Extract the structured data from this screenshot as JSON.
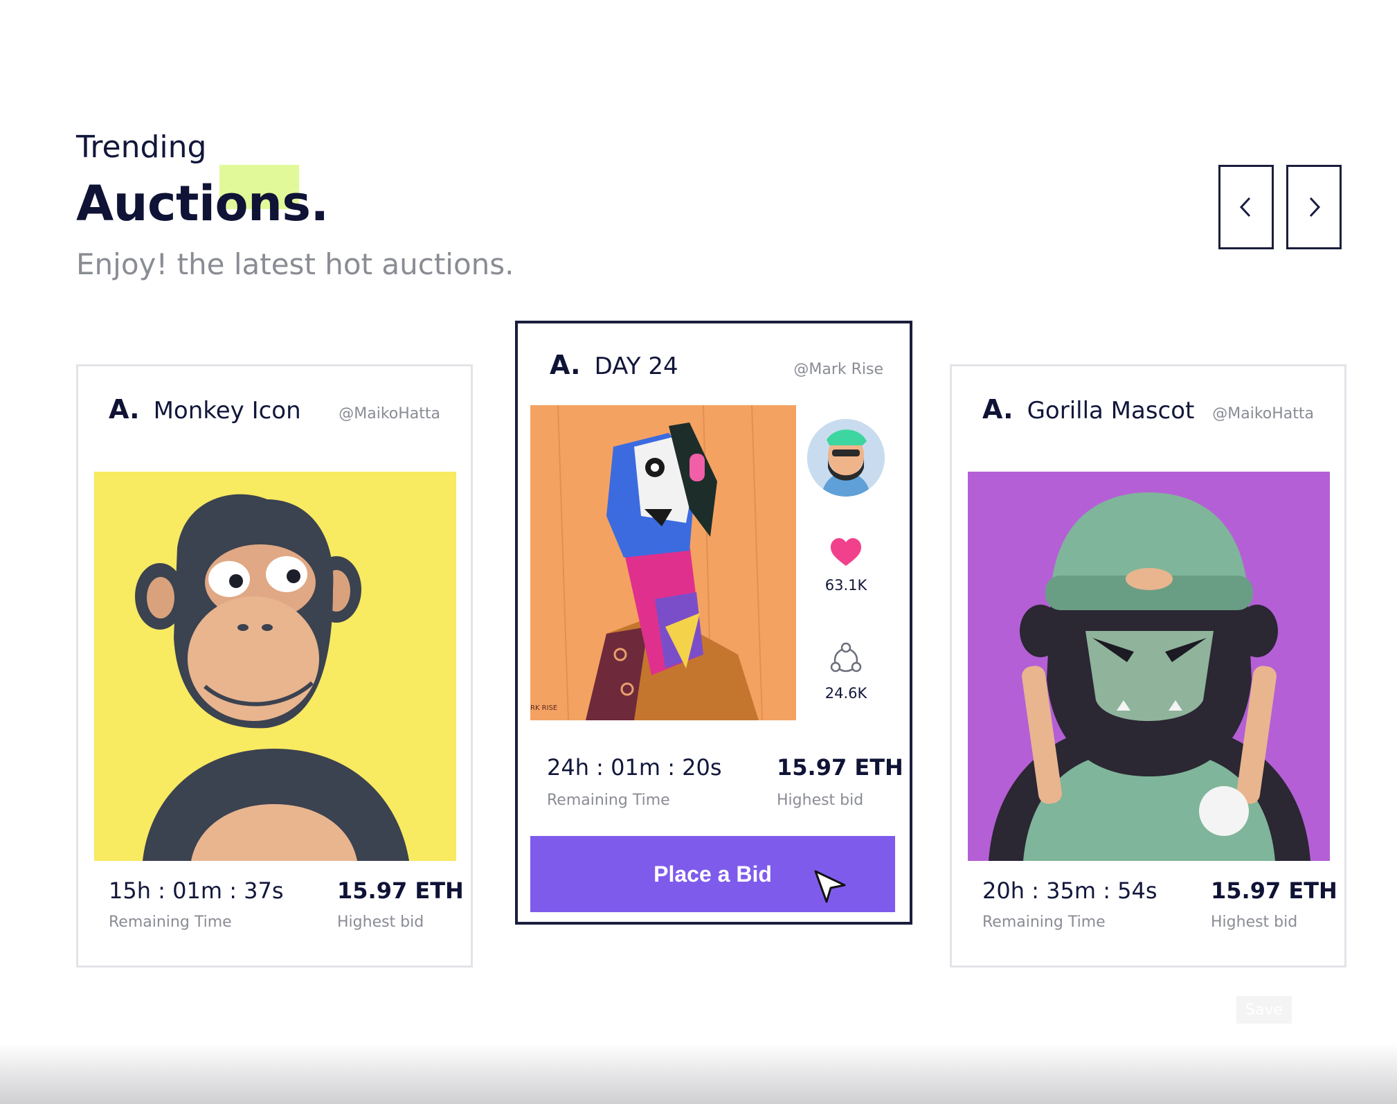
{
  "header": {
    "eyebrow": "Trending",
    "title": "Auctions.",
    "subtitle": "Enjoy! the latest hot auctions.",
    "highlight_color": "#e2f99a"
  },
  "nav": {
    "prev_icon": "chevron-left-icon",
    "next_icon": "chevron-right-icon"
  },
  "cards": [
    {
      "brand": "A.",
      "title": "Monkey Icon",
      "handle": "@MaikoHatta",
      "art_background": "#f8ea61",
      "remaining_time": "15h : 01m : 37s",
      "remaining_label": "Remaining Time",
      "bid": "15.97 ETH",
      "bid_label": "Highest bid"
    },
    {
      "brand": "A.",
      "title": "DAY 24",
      "handle": "@Mark Rise",
      "art_background": "#f4a262",
      "likes": "63.1K",
      "shares": "24.6K",
      "remaining_time": "24h : 01m : 20s",
      "remaining_label": "Remaining Time",
      "bid": "15.97 ETH",
      "bid_label": "Highest bid",
      "button_label": "Place a Bid",
      "button_color": "#7f5bec"
    },
    {
      "brand": "A.",
      "title": "Gorilla Mascot",
      "handle": "@MaikoHatta",
      "art_background": "#b55fd6",
      "remaining_time": "20h : 35m : 54s",
      "remaining_label": "Remaining Time",
      "bid": "15.97 ETH",
      "bid_label": "Highest bid"
    }
  ],
  "save_label": "Save",
  "heart_color": "#f2418c"
}
